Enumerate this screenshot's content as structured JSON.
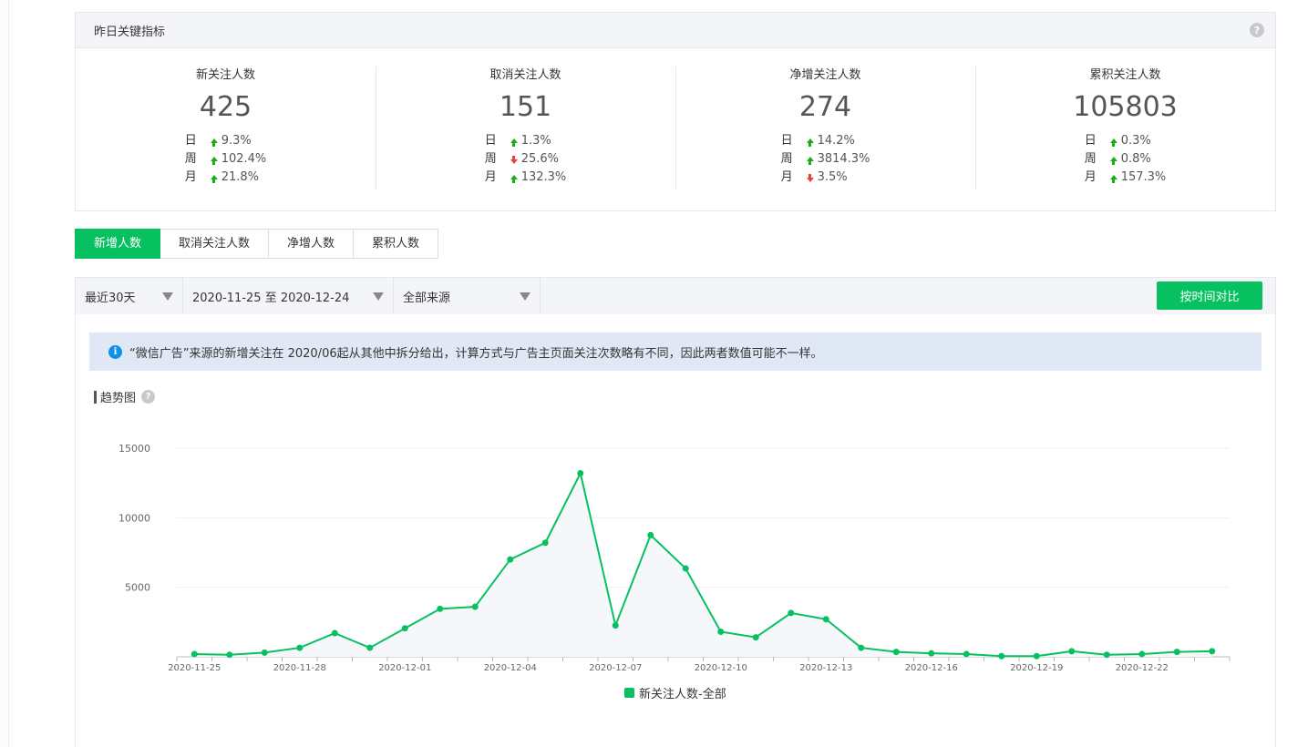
{
  "metrics": {
    "title": "昨日关键指标",
    "help": "?",
    "items": [
      {
        "label": "新关注人数",
        "value": "425",
        "changes": [
          {
            "period": "日",
            "dir": "up",
            "value": "9.3%"
          },
          {
            "period": "周",
            "dir": "up",
            "value": "102.4%"
          },
          {
            "period": "月",
            "dir": "up",
            "value": "21.8%"
          }
        ]
      },
      {
        "label": "取消关注人数",
        "value": "151",
        "changes": [
          {
            "period": "日",
            "dir": "up",
            "value": "1.3%"
          },
          {
            "period": "周",
            "dir": "down",
            "value": "25.6%"
          },
          {
            "period": "月",
            "dir": "up",
            "value": "132.3%"
          }
        ]
      },
      {
        "label": "净增关注人数",
        "value": "274",
        "changes": [
          {
            "period": "日",
            "dir": "up",
            "value": "14.2%"
          },
          {
            "period": "周",
            "dir": "up",
            "value": "3814.3%"
          },
          {
            "period": "月",
            "dir": "down",
            "value": "3.5%"
          }
        ]
      },
      {
        "label": "累积关注人数",
        "value": "105803",
        "changes": [
          {
            "period": "日",
            "dir": "up",
            "value": "0.3%"
          },
          {
            "period": "周",
            "dir": "up",
            "value": "0.8%"
          },
          {
            "period": "月",
            "dir": "up",
            "value": "157.3%"
          }
        ]
      }
    ]
  },
  "tabs": [
    {
      "label": "新增人数",
      "active": true
    },
    {
      "label": "取消关注人数",
      "active": false
    },
    {
      "label": "净增人数",
      "active": false
    },
    {
      "label": "累积人数",
      "active": false
    }
  ],
  "filters": {
    "range": "最近30天",
    "dates": "2020-11-25 至 2020-12-24",
    "source": "全部来源",
    "compare_label": "按时间对比"
  },
  "notice": {
    "icon": "i",
    "text": "“微信广告”来源的新增关注在 2020/06起从其他中拆分给出，计算方式与广告主页面关注次数略有不同，因此两者数值可能不一样。"
  },
  "trend": {
    "title": "趋势图",
    "help": "?"
  },
  "colors": {
    "accent": "#07c160",
    "up": "#1aad19",
    "down": "#e64340"
  },
  "chart_data": {
    "type": "area",
    "title": "",
    "xlabel": "",
    "ylabel": "",
    "ylim": [
      0,
      15000
    ],
    "yticks": [
      5000,
      10000,
      15000
    ],
    "grid": true,
    "legend_position": "bottom",
    "x": [
      "2020-11-25",
      "2020-11-26",
      "2020-11-27",
      "2020-11-28",
      "2020-11-29",
      "2020-11-30",
      "2020-12-01",
      "2020-12-02",
      "2020-12-03",
      "2020-12-04",
      "2020-12-05",
      "2020-12-06",
      "2020-12-07",
      "2020-12-08",
      "2020-12-09",
      "2020-12-10",
      "2020-12-11",
      "2020-12-12",
      "2020-12-13",
      "2020-12-14",
      "2020-12-15",
      "2020-12-16",
      "2020-12-17",
      "2020-12-18",
      "2020-12-19",
      "2020-12-20",
      "2020-12-21",
      "2020-12-22",
      "2020-12-23",
      "2020-12-24"
    ],
    "x_tick_labels": [
      "2020-11-25",
      "2020-11-28",
      "2020-12-01",
      "2020-12-04",
      "2020-12-07",
      "2020-12-10",
      "2020-12-13",
      "2020-12-16",
      "2020-12-19",
      "2020-12-22"
    ],
    "series": [
      {
        "name": "新关注人数-全部",
        "values": [
          200,
          150,
          300,
          650,
          1700,
          650,
          2050,
          3450,
          3600,
          7000,
          8200,
          13200,
          2250,
          8750,
          6350,
          1800,
          1400,
          3150,
          2700,
          650,
          350,
          250,
          200,
          50,
          50,
          400,
          150,
          200,
          350,
          400
        ]
      }
    ]
  }
}
